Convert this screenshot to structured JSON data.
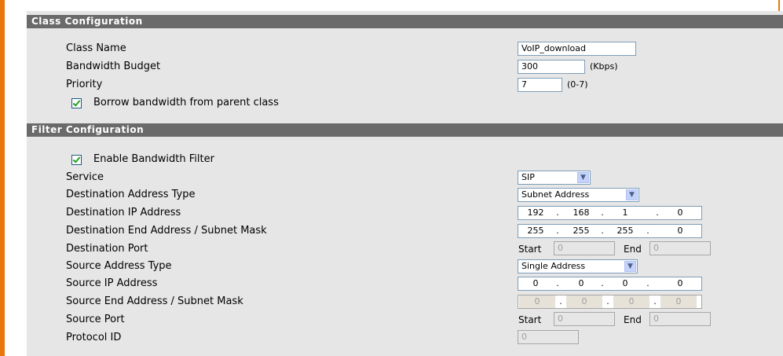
{
  "class_config": {
    "header": "Class Configuration",
    "class_name_label": "Class Name",
    "class_name_value": "VoIP_download",
    "bandwidth_label": "Bandwidth Budget",
    "bandwidth_value": "300",
    "bandwidth_unit": "(Kbps)",
    "priority_label": "Priority",
    "priority_value": "7",
    "priority_range": "(0-7)",
    "borrow_label": "Borrow bandwidth from parent class",
    "borrow_checked": true
  },
  "filter_config": {
    "header": "Filter Configuration",
    "enable_label": "Enable Bandwidth Filter",
    "enable_checked": true,
    "service_label": "Service",
    "service_value": "SIP",
    "dest_addr_type_label": "Destination Address Type",
    "dest_addr_type_value": "Subnet Address",
    "dest_ip_label": "Destination IP Address",
    "dest_ip": [
      "192",
      "168",
      "1",
      "0"
    ],
    "dest_end_label": "Destination End Address / Subnet Mask",
    "dest_end": [
      "255",
      "255",
      "255",
      "0"
    ],
    "dest_port_label": "Destination Port",
    "dest_port_start": "0",
    "dest_port_end": "0",
    "src_addr_type_label": "Source Address Type",
    "src_addr_type_value": "Single Address",
    "src_ip_label": "Source IP Address",
    "src_ip": [
      "0",
      "0",
      "0",
      "0"
    ],
    "src_end_label": "Source End Address / Subnet Mask",
    "src_end": [
      "0",
      "0",
      "0",
      "0"
    ],
    "src_port_label": "Source Port",
    "src_port_start": "0",
    "src_port_end": "0",
    "protocol_label": "Protocol ID",
    "protocol_value": "0",
    "start_label": "Start",
    "end_label": "End",
    "dot": "."
  },
  "icons": {
    "dropdown_arrow": "chevron-down-icon",
    "checkbox": "checkmark-icon"
  },
  "colors": {
    "accent_orange": "#e8780e",
    "header_gray": "#6a6a6a",
    "panel_gray": "#e6e6e6"
  }
}
